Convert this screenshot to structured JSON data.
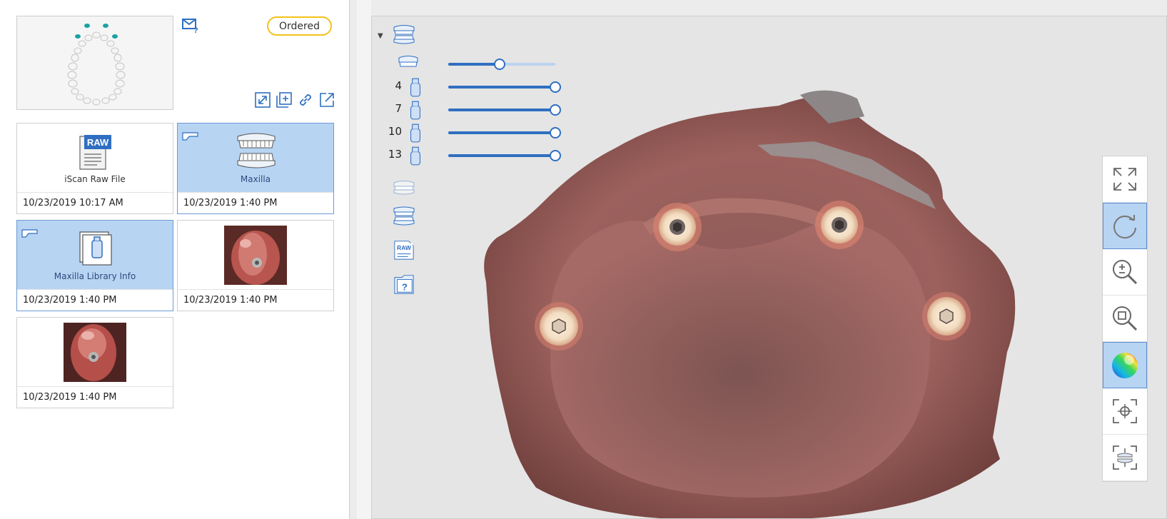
{
  "header": {
    "status": "Ordered"
  },
  "left_panel": {
    "tooth_chart": {
      "icon": "dental-arch-chart"
    },
    "toolbar_icons": [
      "expand-icon",
      "add-copy-icon",
      "link-icon",
      "export-icon"
    ],
    "cards": [
      {
        "label": "iScan Raw File",
        "date": "10/23/2019 10:17 AM",
        "icon": "raw-file-icon",
        "selected": false
      },
      {
        "label": "Maxilla",
        "date": "10/23/2019 1:40 PM",
        "icon": "maxilla-model-icon",
        "selected": true
      },
      {
        "label": "Maxilla Library Info",
        "date": "10/23/2019 1:40 PM",
        "icon": "library-info-icon",
        "selected": true
      },
      {
        "label": "",
        "date": "10/23/2019 1:40 PM",
        "icon": "clinical-photo",
        "selected": false
      },
      {
        "label": "",
        "date": "10/23/2019 1:40 PM",
        "icon": "clinical-photo",
        "selected": false
      }
    ]
  },
  "viewer": {
    "layers": {
      "slider_rows": [
        {
          "number": "",
          "value": 0.48
        },
        {
          "number": "4",
          "value": 1.0
        },
        {
          "number": "7",
          "value": 1.0
        },
        {
          "number": "10",
          "value": 1.0
        },
        {
          "number": "13",
          "value": 1.0
        }
      ],
      "raw_label": "RAW"
    },
    "right_toolbar": [
      {
        "name": "fit-screen-icon",
        "active": false
      },
      {
        "name": "rotate-icon",
        "active": true
      },
      {
        "name": "zoom-icon",
        "active": false
      },
      {
        "name": "zoom-fit-icon",
        "active": false
      },
      {
        "name": "color-map-icon",
        "active": true
      },
      {
        "name": "center-target-icon",
        "active": false
      },
      {
        "name": "view-align-icon",
        "active": false
      }
    ]
  },
  "colors": {
    "accent": "#2f6fc1",
    "selected_bg": "#b8d4f3",
    "badge_border": "#f2c21c"
  }
}
